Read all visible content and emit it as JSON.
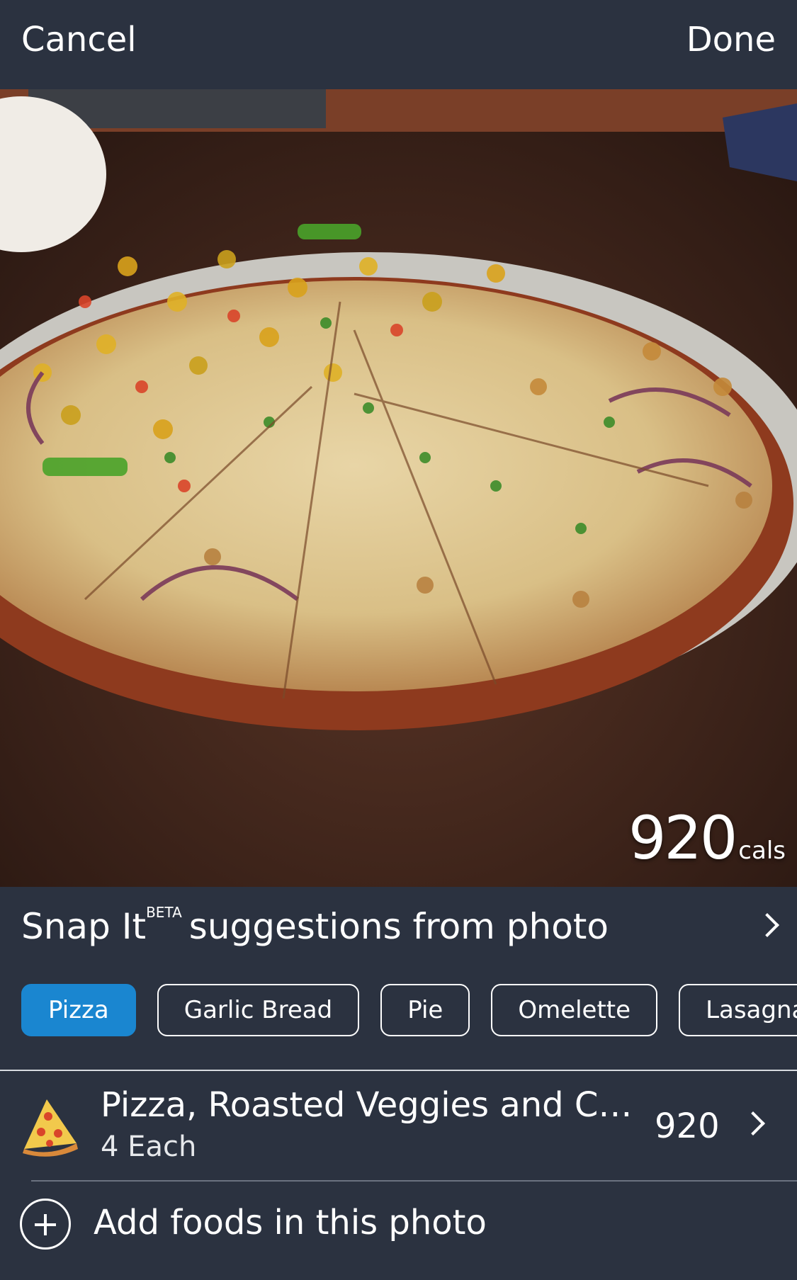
{
  "header": {
    "cancel_label": "Cancel",
    "done_label": "Done"
  },
  "photo": {
    "subject": "pizza-photo",
    "calories": "920",
    "calories_unit": "cals"
  },
  "suggestions": {
    "title_prefix": "Snap It",
    "title_badge": "BETA",
    "title_suffix": "suggestions from photo",
    "chips": [
      {
        "label": "Pizza",
        "selected": true
      },
      {
        "label": "Garlic Bread",
        "selected": false
      },
      {
        "label": "Pie",
        "selected": false
      },
      {
        "label": "Omelette",
        "selected": false
      },
      {
        "label": "Lasagna",
        "selected": false
      }
    ]
  },
  "food_item": {
    "icon": "pizza-slice-icon",
    "name": "Pizza, Roasted Veggies and Chi…",
    "serving": "4 Each",
    "calories": "920"
  },
  "add_foods": {
    "icon": "plus-circle-icon",
    "label": "Add foods in this photo"
  },
  "colors": {
    "background": "#2b3240",
    "accent": "#1a86d0"
  }
}
